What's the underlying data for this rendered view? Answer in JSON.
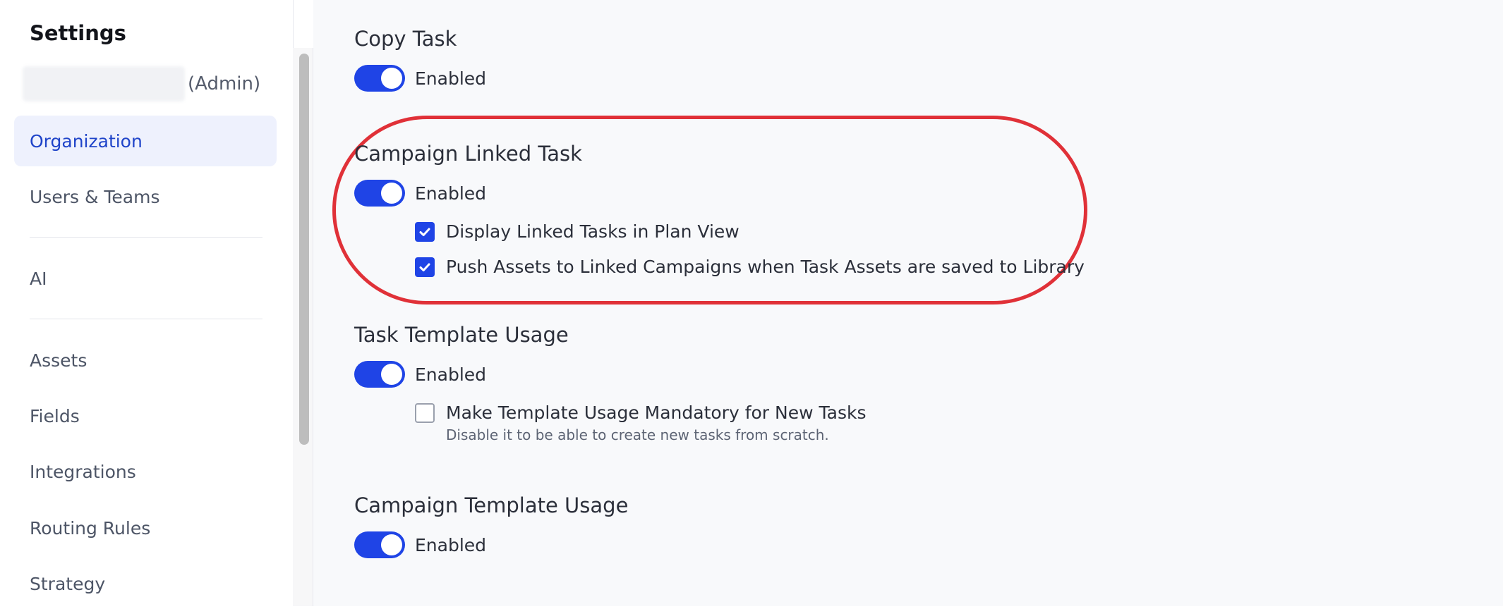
{
  "sidebar": {
    "title": "Settings",
    "account_role": "(Admin)",
    "items": [
      {
        "label": "Organization"
      },
      {
        "label": "Users & Teams"
      },
      {
        "label": "AI"
      },
      {
        "label": "Assets"
      },
      {
        "label": "Fields"
      },
      {
        "label": "Integrations"
      },
      {
        "label": "Routing Rules"
      },
      {
        "label": "Strategy"
      }
    ],
    "active_item": "Organization"
  },
  "main": {
    "sections": [
      {
        "title": "Copy Task",
        "toggle": {
          "label": "Enabled",
          "on": true
        }
      },
      {
        "title": "Campaign Linked Task",
        "toggle": {
          "label": "Enabled",
          "on": true
        },
        "options": [
          {
            "label": "Display Linked Tasks in Plan View",
            "checked": true
          },
          {
            "label": "Push Assets to Linked Campaigns when Task Assets are saved to Library",
            "checked": true
          }
        ]
      },
      {
        "title": "Task Template Usage",
        "toggle": {
          "label": "Enabled",
          "on": true
        },
        "options": [
          {
            "label": "Make Template Usage Mandatory for New Tasks",
            "checked": false,
            "help": "Disable it to be able to create new tasks from scratch."
          }
        ]
      },
      {
        "title": "Campaign Template Usage",
        "toggle": {
          "label": "Enabled",
          "on": true
        }
      }
    ]
  },
  "colors": {
    "accent": "#1f44e6",
    "active_nav_bg": "#eef1fd",
    "highlight_ring": "#e03138"
  },
  "icons": {
    "check": "checkmark-icon"
  }
}
